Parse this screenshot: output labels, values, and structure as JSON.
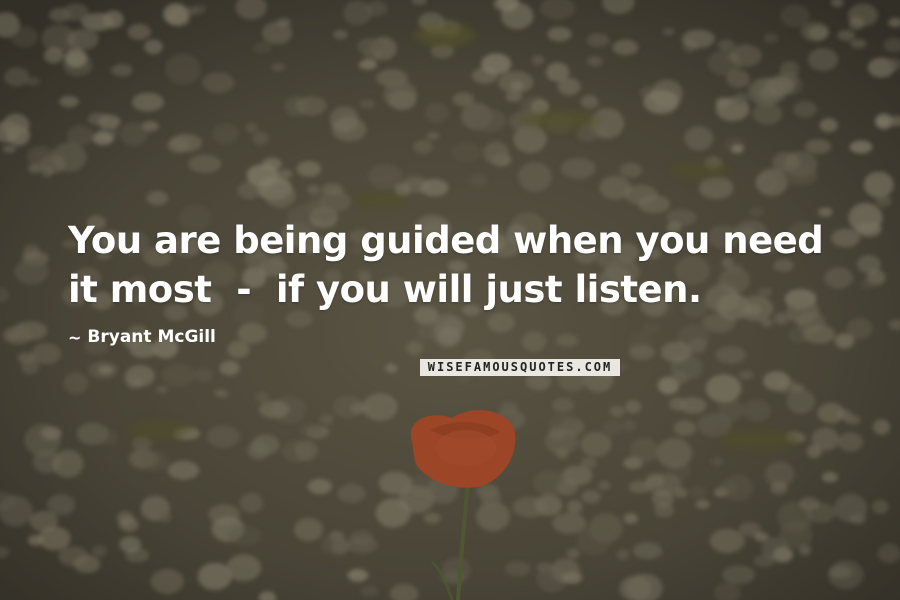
{
  "quote": {
    "line1": "You are being guided when you need",
    "line2": "it most  -  if you will just listen."
  },
  "author": {
    "prefix": "~",
    "name": "Bryant McGill"
  },
  "watermark": {
    "text": "WISEFAMOUSQUOTES.COM"
  },
  "colors": {
    "text": "#ffffff",
    "background": "#4a4537",
    "poppy": "#c8512a",
    "stem": "#5a6a3a"
  }
}
